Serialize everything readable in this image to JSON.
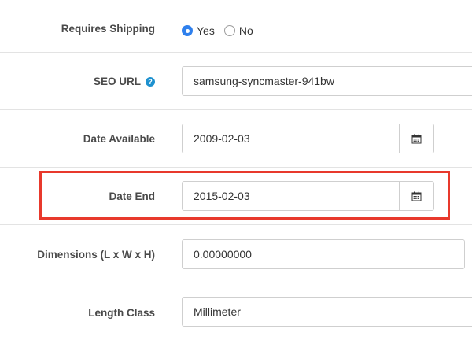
{
  "requires_shipping": {
    "label": "Requires Shipping",
    "options": [
      {
        "label": "Yes",
        "checked": true
      },
      {
        "label": "No",
        "checked": false
      }
    ]
  },
  "seo_url": {
    "label": "SEO URL",
    "help_icon": "?",
    "value": "samsung-syncmaster-941bw"
  },
  "date_available": {
    "label": "Date Available",
    "value": "2009-02-03",
    "button_icon": "calendar-icon"
  },
  "date_end": {
    "label": "Date End",
    "value": "2015-02-03",
    "button_icon": "calendar-icon"
  },
  "dimensions": {
    "label": "Dimensions (L x W x H)",
    "value": "0.00000000"
  },
  "length_class": {
    "label": "Length Class",
    "value": "Millimeter"
  },
  "colors": {
    "highlight": "#e8392c",
    "radio_accent": "#2f80ed",
    "help_icon": "#1e91cf"
  }
}
